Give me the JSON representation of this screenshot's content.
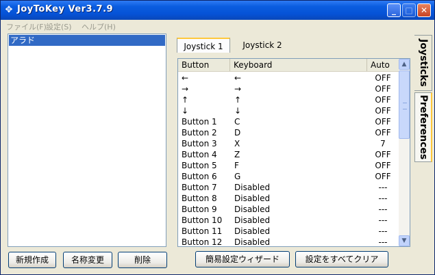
{
  "window": {
    "title": "JoyToKey Ver3.7.9",
    "icon": "joystick-icon"
  },
  "title_buttons": {
    "minimize": "_",
    "maximize": "□",
    "close": "✕"
  },
  "menu": [
    {
      "label": "ファイル(F)"
    },
    {
      "label": "設定(S)"
    },
    {
      "label": "ヘルプ(H)"
    }
  ],
  "configs": {
    "items": [
      "アラド"
    ],
    "selected_index": 0
  },
  "left_buttons": {
    "new": "新規作成",
    "rename": "名称変更",
    "delete": "削除"
  },
  "tabs": [
    {
      "label": "Joystick 1",
      "active": true
    },
    {
      "label": "Joystick 2",
      "active": false
    }
  ],
  "side_tabs": {
    "joysticks": "Joysticks",
    "preferences": "Preferences"
  },
  "table": {
    "columns": [
      "Button",
      "Keyboard",
      "Auto"
    ],
    "rows": [
      {
        "button": "←",
        "keyboard": "←",
        "auto": "OFF"
      },
      {
        "button": "→",
        "keyboard": "→",
        "auto": "OFF"
      },
      {
        "button": "↑",
        "keyboard": "↑",
        "auto": "OFF"
      },
      {
        "button": "↓",
        "keyboard": "↓",
        "auto": "OFF"
      },
      {
        "button": "Button 1",
        "keyboard": "C",
        "auto": "OFF"
      },
      {
        "button": "Button 2",
        "keyboard": "D",
        "auto": "OFF"
      },
      {
        "button": "Button 3",
        "keyboard": "X",
        "auto": "7"
      },
      {
        "button": "Button 4",
        "keyboard": "Z",
        "auto": "OFF"
      },
      {
        "button": "Button 5",
        "keyboard": "F",
        "auto": "OFF"
      },
      {
        "button": "Button 6",
        "keyboard": "G",
        "auto": "OFF"
      },
      {
        "button": "Button 7",
        "keyboard": "Disabled",
        "auto": "---"
      },
      {
        "button": "Button 8",
        "keyboard": "Disabled",
        "auto": "---"
      },
      {
        "button": "Button 9",
        "keyboard": "Disabled",
        "auto": "---"
      },
      {
        "button": "Button 10",
        "keyboard": "Disabled",
        "auto": "---"
      },
      {
        "button": "Button 11",
        "keyboard": "Disabled",
        "auto": "---"
      },
      {
        "button": "Button 12",
        "keyboard": "Disabled",
        "auto": "---"
      }
    ]
  },
  "scrollbar": {
    "up_icon": "▲",
    "down_icon": "▼"
  },
  "bottom_buttons": {
    "wizard": "簡易設定ウィザード",
    "clear_all": "設定をすべてクリア"
  }
}
